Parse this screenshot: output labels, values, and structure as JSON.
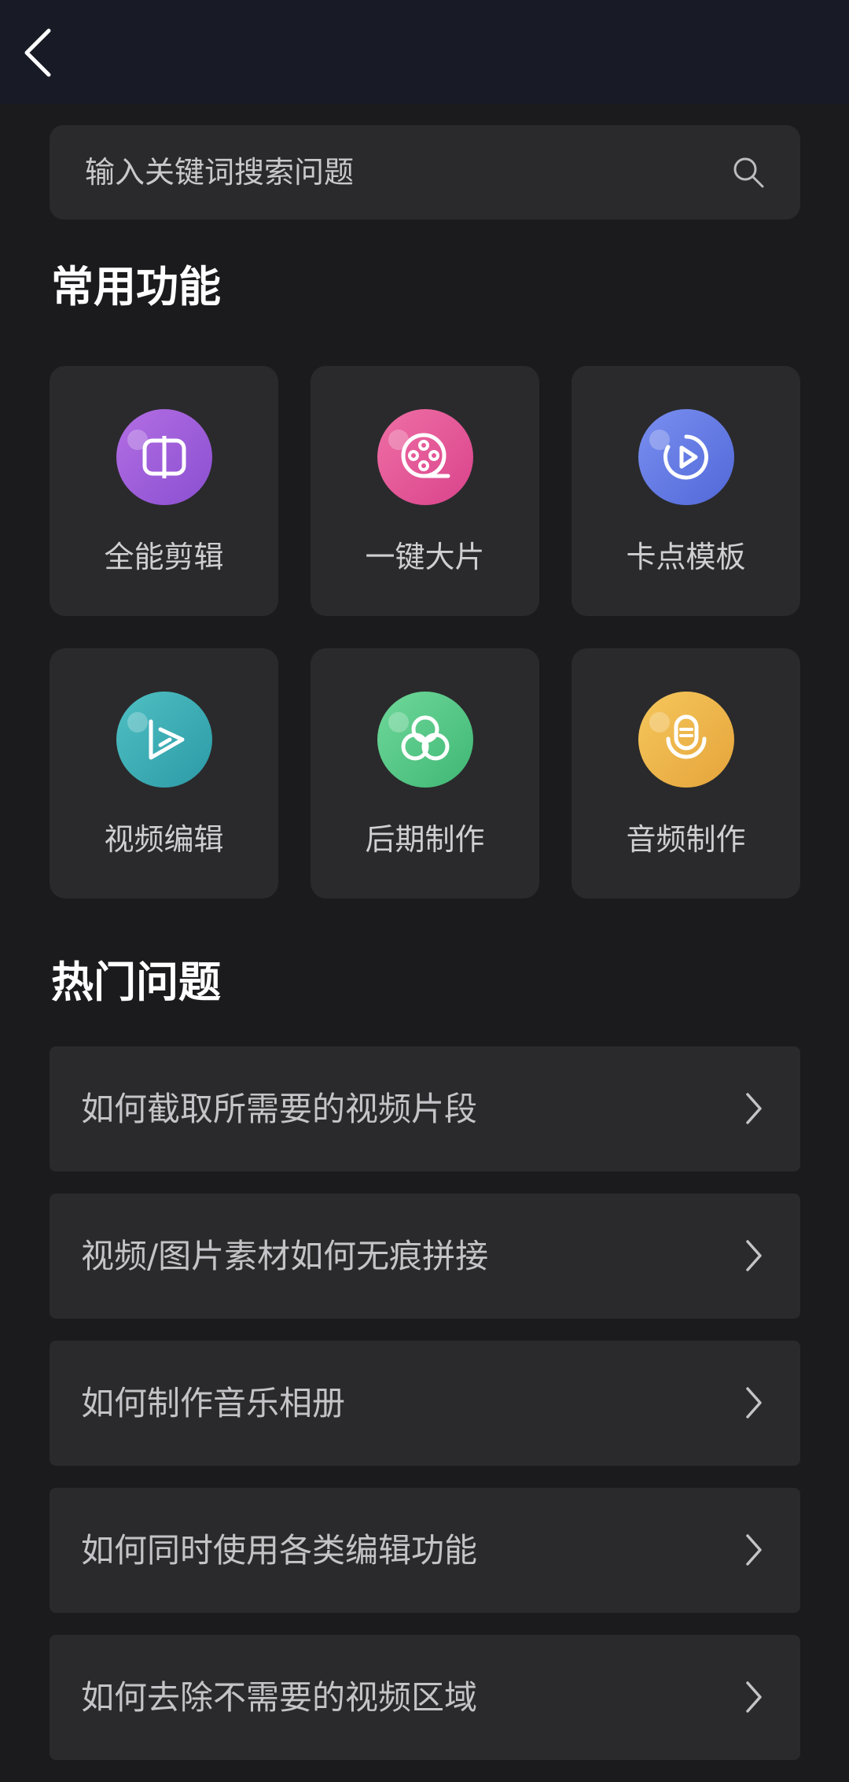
{
  "header": {
    "back_icon": "chevron-left-icon"
  },
  "search": {
    "placeholder": "输入关键词搜索问题",
    "icon": "search-icon"
  },
  "sections": {
    "common_title": "常用功能",
    "hot_title": "热门问题"
  },
  "features": [
    {
      "label": "全能剪辑",
      "icon": "split-edit-icon",
      "color": "#a35cdc"
    },
    {
      "label": "一键大片",
      "icon": "film-reel-icon",
      "color": "#e4579a"
    },
    {
      "label": "卡点模板",
      "icon": "play-circle-icon",
      "color": "#6279e3"
    },
    {
      "label": "视频编辑",
      "icon": "play-triangle-icon",
      "color": "#3badb4"
    },
    {
      "label": "后期制作",
      "icon": "three-circles-icon",
      "color": "#52c785"
    },
    {
      "label": "音频制作",
      "icon": "microphone-icon",
      "color": "#eeb44a"
    }
  ],
  "questions": [
    {
      "text": "如何截取所需要的视频片段"
    },
    {
      "text": "视频/图片素材如何无痕拼接"
    },
    {
      "text": "如何制作音乐相册"
    },
    {
      "text": "如何同时使用各类编辑功能"
    },
    {
      "text": "如何去除不需要的视频区域"
    }
  ]
}
